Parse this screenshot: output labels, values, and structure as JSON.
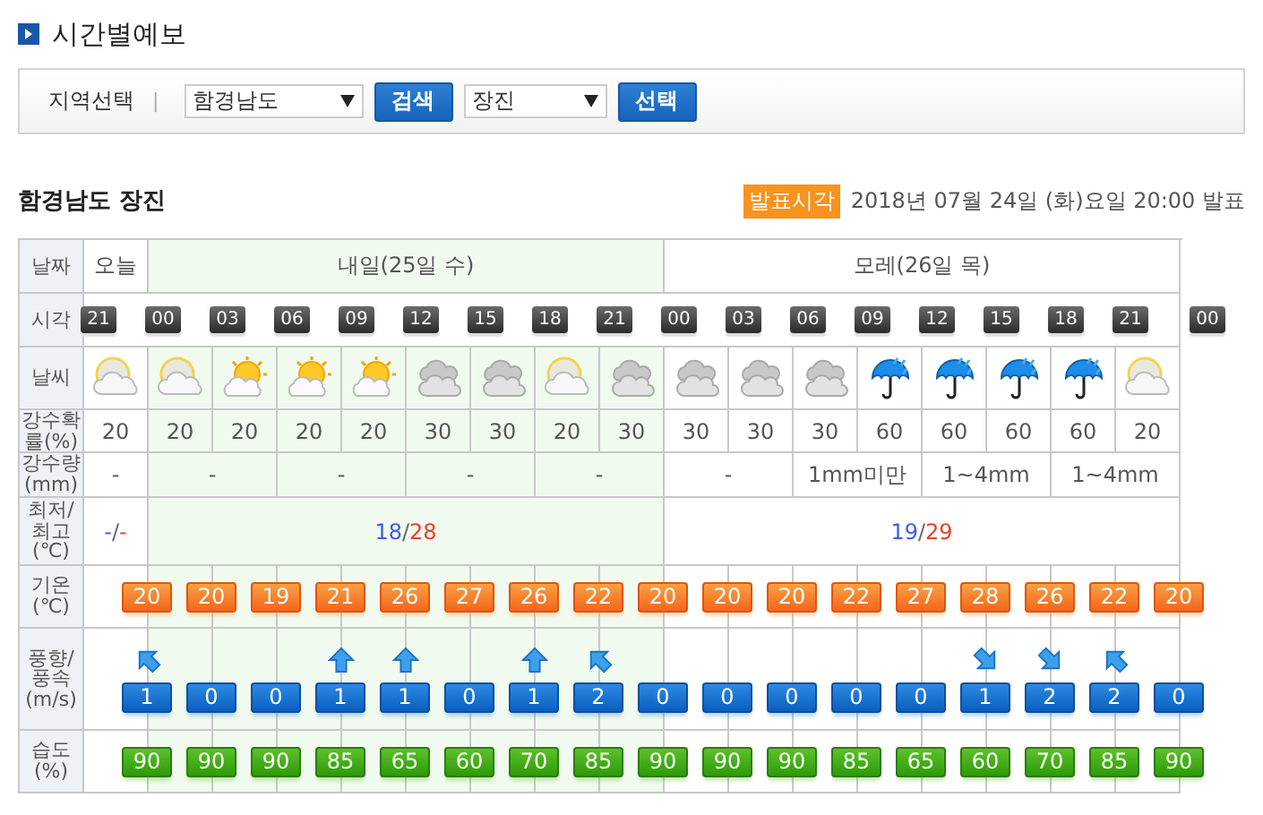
{
  "page_title": "시간별예보",
  "search": {
    "label": "지역선택",
    "separator": "|",
    "province": "함경남도",
    "search_button": "검색",
    "city": "장진",
    "select_button": "선택"
  },
  "location": "함경남도 장진",
  "issued": {
    "badge": "발표시각",
    "text": "2018년 07월 24일 (화)요일 20:00 발표"
  },
  "table": {
    "row_labels": [
      "날짜",
      "시각",
      "날씨",
      "강수확률(%)",
      "강수량(mm)",
      "최저/ 최고 (℃)",
      "기온 (℃)",
      "풍향/ 풍속 (m/s)",
      "습도 (%)"
    ],
    "times": [
      "21",
      "00",
      "03",
      "06",
      "09",
      "12",
      "15",
      "18",
      "21",
      "00",
      "03",
      "06",
      "09",
      "12",
      "15",
      "18",
      "21",
      "00"
    ],
    "days": [
      {
        "label": "오늘",
        "highlighted": false,
        "min": "-",
        "separator": "/",
        "max": "-",
        "rain_amounts": [
          "-"
        ],
        "hours": [
          {
            "kind": "moon_cloud",
            "rain_chance": "20"
          }
        ]
      },
      {
        "label": "내일(25일 수)",
        "highlighted": true,
        "min": "18",
        "separator": "/",
        "max": "28",
        "rain_amounts": [
          "-",
          "-",
          "-",
          "-"
        ],
        "hours": [
          {
            "kind": "moon_cloud",
            "rain_chance": "20"
          },
          {
            "kind": "sun_cloud",
            "rain_chance": "20"
          },
          {
            "kind": "sun_cloud",
            "rain_chance": "20"
          },
          {
            "kind": "sun_cloud",
            "rain_chance": "20"
          },
          {
            "kind": "cloudy",
            "rain_chance": "30"
          },
          {
            "kind": "cloudy",
            "rain_chance": "30"
          },
          {
            "kind": "moon_cloud",
            "rain_chance": "20"
          },
          {
            "kind": "cloudy",
            "rain_chance": "30"
          }
        ]
      },
      {
        "label": "모레(26일 목)",
        "highlighted": false,
        "min": "19",
        "separator": "/",
        "max": "29",
        "rain_amounts": [
          "-",
          "1mm미만",
          "1~4mm",
          "1~4mm"
        ],
        "hours": [
          {
            "kind": "cloudy",
            "rain_chance": "30"
          },
          {
            "kind": "cloudy",
            "rain_chance": "30"
          },
          {
            "kind": "cloudy",
            "rain_chance": "30"
          },
          {
            "kind": "rain",
            "rain_chance": "60"
          },
          {
            "kind": "rain",
            "rain_chance": "60"
          },
          {
            "kind": "rain",
            "rain_chance": "60"
          },
          {
            "kind": "rain",
            "rain_chance": "60"
          },
          {
            "kind": "moon_cloud",
            "rain_chance": "20"
          }
        ]
      }
    ],
    "temperatures": [
      "20",
      "20",
      "19",
      "21",
      "26",
      "27",
      "26",
      "22",
      "20",
      "20",
      "20",
      "22",
      "27",
      "28",
      "26",
      "22",
      "20"
    ],
    "winds": [
      {
        "kind": "northwest",
        "speed": "1"
      },
      {
        "kind": "none",
        "speed": "0"
      },
      {
        "kind": "none",
        "speed": "0"
      },
      {
        "kind": "north",
        "speed": "1"
      },
      {
        "kind": "north",
        "speed": "1"
      },
      {
        "kind": "none",
        "speed": "0"
      },
      {
        "kind": "north",
        "speed": "1"
      },
      {
        "kind": "northwest",
        "speed": "2"
      },
      {
        "kind": "none",
        "speed": "0"
      },
      {
        "kind": "none",
        "speed": "0"
      },
      {
        "kind": "none",
        "speed": "0"
      },
      {
        "kind": "none",
        "speed": "0"
      },
      {
        "kind": "none",
        "speed": "0"
      },
      {
        "kind": "southeast",
        "speed": "1"
      },
      {
        "kind": "southeast",
        "speed": "2"
      },
      {
        "kind": "northwest",
        "speed": "2"
      },
      {
        "kind": "none",
        "speed": "0"
      }
    ],
    "humidity": [
      "90",
      "90",
      "90",
      "85",
      "65",
      "60",
      "70",
      "85",
      "90",
      "90",
      "90",
      "85",
      "65",
      "60",
      "70",
      "85",
      "90"
    ]
  }
}
